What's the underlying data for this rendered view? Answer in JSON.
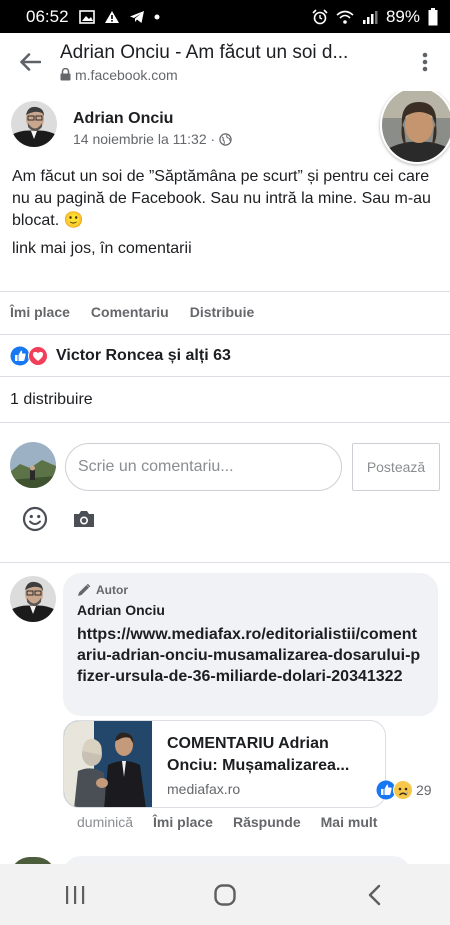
{
  "status_bar": {
    "time": "06:52",
    "battery": "89%"
  },
  "browser": {
    "title": "Adrian Onciu - Am făcut un soi d...",
    "url": "m.facebook.com"
  },
  "post": {
    "author": "Adrian Onciu",
    "date": "14 noiembrie la 11:32 ·",
    "text_line1": "Am făcut un soi de ”Săptămâna pe scurt” și pentru cei care nu au pagină de Facebook. Sau nu intră la mine. Sau m-au blocat. 🙂",
    "text_line2": "link mai jos, în comentarii"
  },
  "post_actions": {
    "like": "Îmi place",
    "comment": "Comentariu",
    "share": "Distribuie"
  },
  "reactions": {
    "label": "Victor Roncea și alți 63"
  },
  "shares": {
    "label": "1 distribuire"
  },
  "composer": {
    "placeholder": "Scrie un comentariu...",
    "post_button": "Postează"
  },
  "comment": {
    "badge": "Autor",
    "author": "Adrian Onciu",
    "link": "https://www.mediafax.ro/editorialistii/comentariu-adrian-onciu-musamalizarea-dosarului-pfizer-ursula-de-36-miliarde-dolari-20341322",
    "preview_title": "COMENTARIU Adrian Onciu: Mușamalizarea...",
    "preview_domain": "mediafax.ro",
    "reaction_count": "29",
    "time": "duminică",
    "like": "Îmi place",
    "reply": "Răspunde",
    "more": "Mai mult"
  },
  "colors": {
    "like_blue": "#1877f2",
    "love_red": "#f33e58",
    "text_secondary": "#65676b",
    "bubble_bg": "#f0f2f5"
  }
}
